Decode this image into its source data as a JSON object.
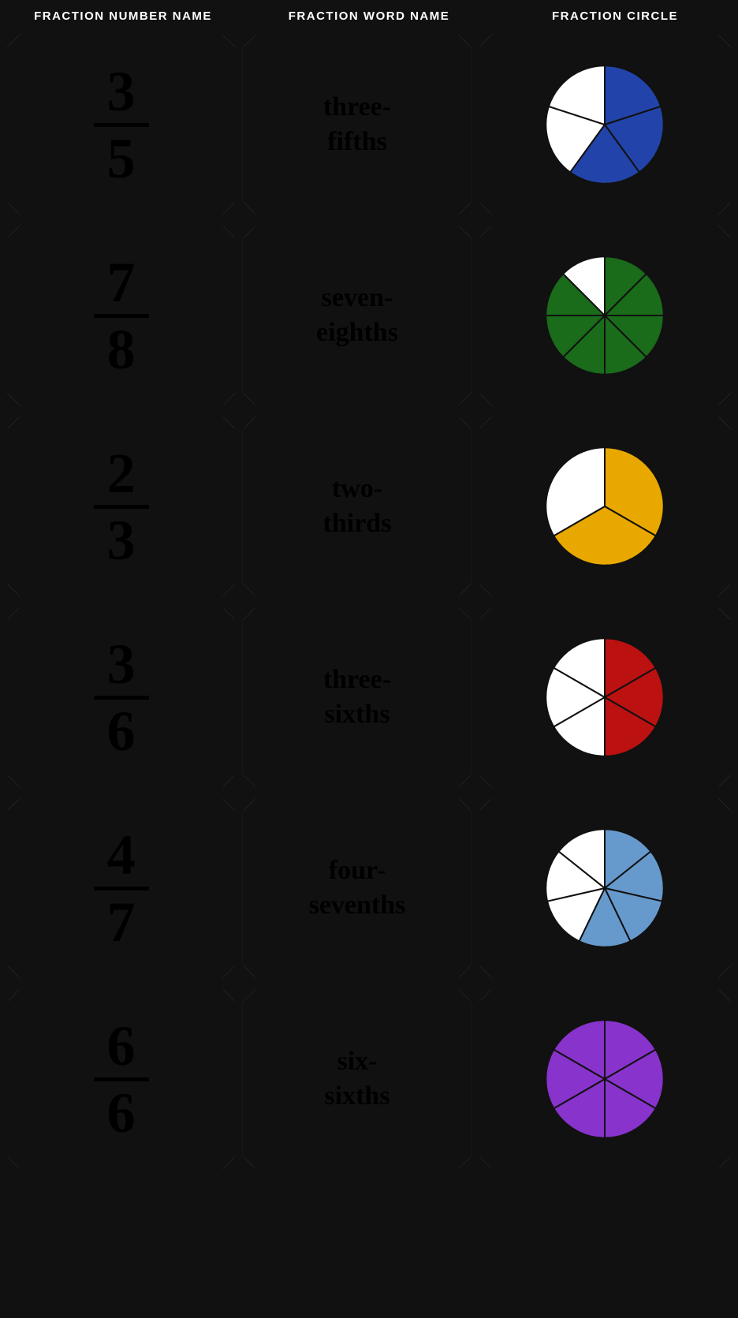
{
  "header": {
    "col1": "FRACTION NUMBER NAME",
    "col2": "FRACTION WORD NAME",
    "col3": "FRACTION CIRCLE"
  },
  "rows": [
    {
      "numerator": "3",
      "denominator": "5",
      "word_line1": "three-",
      "word_line2": "fifths",
      "filled": 3,
      "total": 5,
      "color": "#2244AA"
    },
    {
      "numerator": "7",
      "denominator": "8",
      "word_line1": "seven-",
      "word_line2": "eighths",
      "filled": 7,
      "total": 8,
      "color": "#1a6b1a"
    },
    {
      "numerator": "2",
      "denominator": "3",
      "word_line1": "two-",
      "word_line2": "thirds",
      "filled": 2,
      "total": 3,
      "color": "#e8a800"
    },
    {
      "numerator": "3",
      "denominator": "6",
      "word_line1": "three-",
      "word_line2": "sixths",
      "filled": 3,
      "total": 6,
      "color": "#bb1111"
    },
    {
      "numerator": "4",
      "denominator": "7",
      "word_line1": "four-",
      "word_line2": "sevenths",
      "filled": 4,
      "total": 7,
      "color": "#6699cc"
    },
    {
      "numerator": "6",
      "denominator": "6",
      "word_line1": "six-",
      "word_line2": "sixths",
      "filled": 6,
      "total": 6,
      "color": "#8833cc"
    }
  ]
}
